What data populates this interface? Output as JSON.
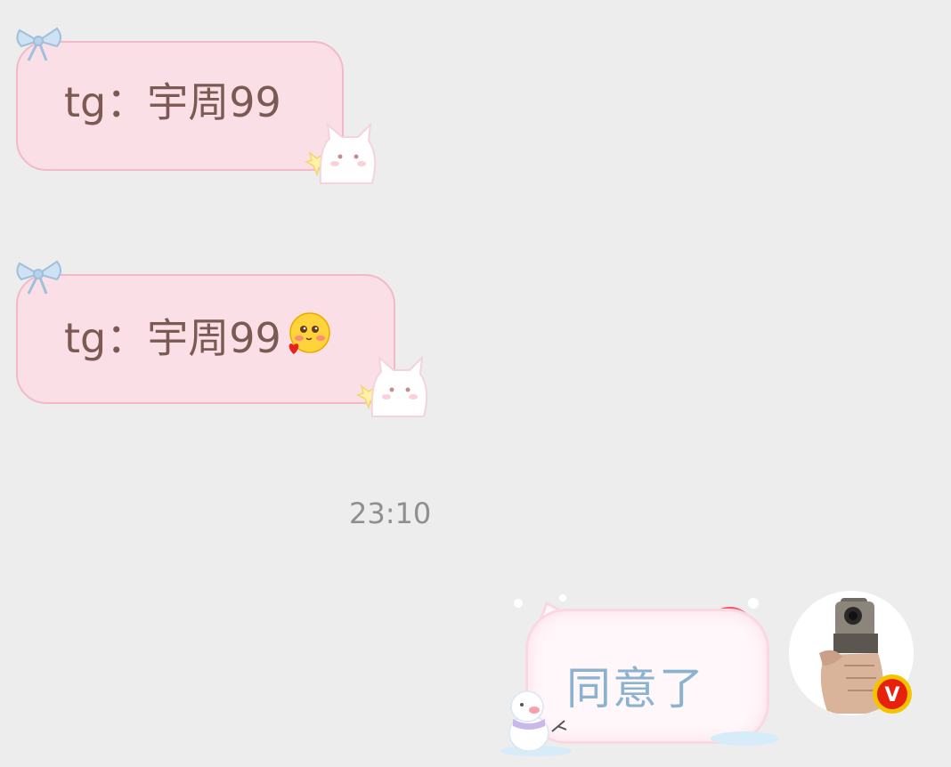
{
  "messages": [
    {
      "sender": "other",
      "text": "tg：宇周99"
    },
    {
      "sender": "other",
      "text": "tg：宇周99",
      "emoji": "blushing-heart-emoji"
    }
  ],
  "timestamp": "23:10",
  "reply": {
    "sender": "self",
    "text": "同意了",
    "badge": "V"
  },
  "colors": {
    "background": "#ededed",
    "incoming_bubble": "#fbdfe6",
    "incoming_text": "#7a5a52",
    "outgoing_text": "#8bb3cf",
    "badge": "#e8210f"
  }
}
